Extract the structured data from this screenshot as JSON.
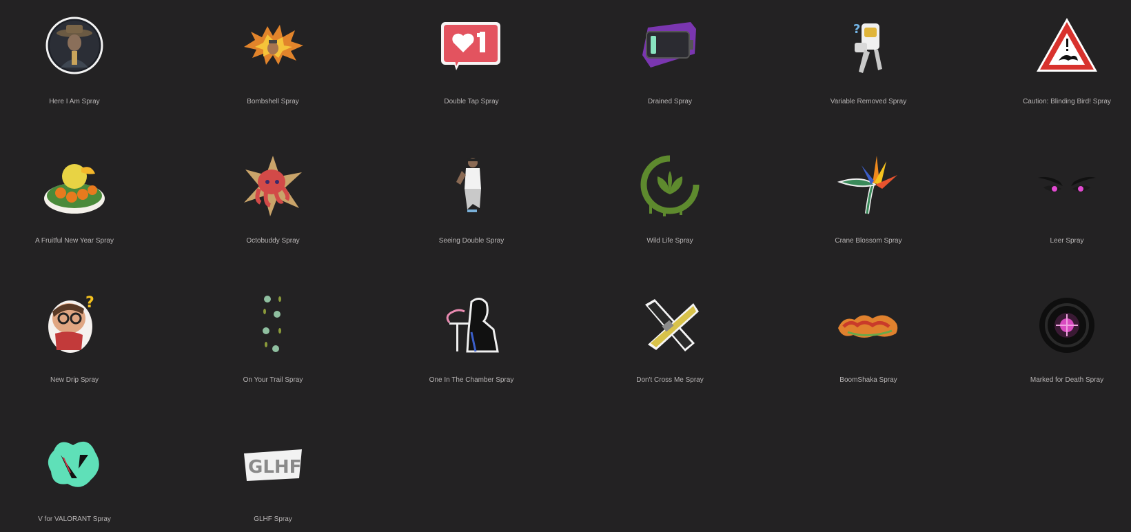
{
  "sprays": [
    {
      "label": "Here I Am Spray",
      "icon": "cowboy-portrait-icon"
    },
    {
      "label": "Bombshell Spray",
      "icon": "explosion-icon"
    },
    {
      "label": "Double Tap Spray",
      "icon": "heart-like-notification-icon"
    },
    {
      "label": "Drained Spray",
      "icon": "low-battery-icon"
    },
    {
      "label": "Variable Removed Spray",
      "icon": "robot-question-icon"
    },
    {
      "label": "Caution: Blinding Bird! Spray",
      "icon": "warning-triangle-bird-icon"
    },
    {
      "label": "A Fruitful New Year Spray",
      "icon": "fruit-basket-icon"
    },
    {
      "label": "Octobuddy Spray",
      "icon": "octopus-star-icon"
    },
    {
      "label": "Seeing Double Spray",
      "icon": "kneeling-figure-icon"
    },
    {
      "label": "Wild Life Spray",
      "icon": "sprout-circle-icon"
    },
    {
      "label": "Crane Blossom Spray",
      "icon": "bird-of-paradise-flower-icon"
    },
    {
      "label": "Leer Spray",
      "icon": "glaring-eyes-icon"
    },
    {
      "label": "New Drip Spray",
      "icon": "nerd-character-icon"
    },
    {
      "label": "On Your Trail Spray",
      "icon": "paw-prints-icon"
    },
    {
      "label": "One In The Chamber Spray",
      "icon": "silhouette-smoking-icon"
    },
    {
      "label": "Don't Cross Me Spray",
      "icon": "crossed-tools-icon"
    },
    {
      "label": "BoomShaka Spray",
      "icon": "graffiti-text-icon"
    },
    {
      "label": "Marked for Death Spray",
      "icon": "target-reticle-icon"
    },
    {
      "label": "V for VALORANT Spray",
      "icon": "valorant-v-splatter-icon"
    },
    {
      "label": "GLHF Spray",
      "icon": "glhf-graffiti-icon"
    }
  ]
}
